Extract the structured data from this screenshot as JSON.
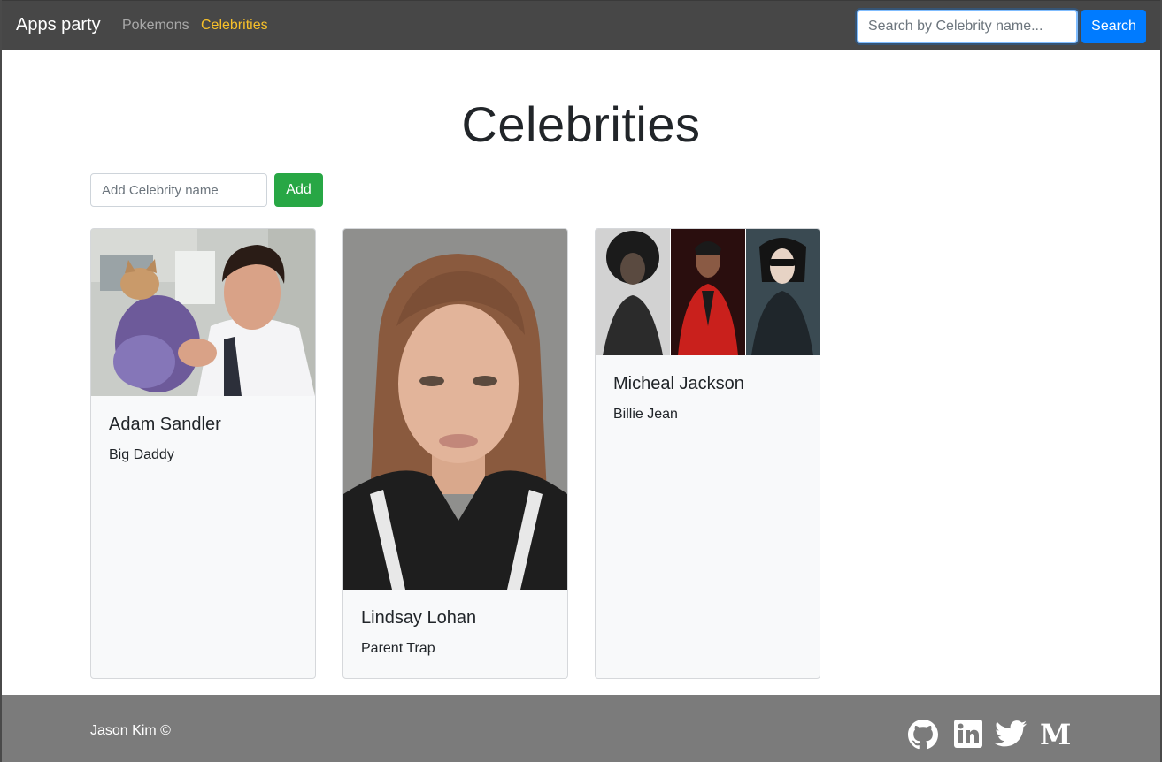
{
  "navbar": {
    "brand": "Apps party",
    "links": [
      {
        "label": "Pokemons",
        "active": false
      },
      {
        "label": "Celebrities",
        "active": true
      }
    ],
    "search": {
      "placeholder": "Search by Celebrity name...",
      "value": "",
      "button_label": "Search"
    }
  },
  "main": {
    "title": "Celebrities",
    "add": {
      "placeholder": "Add Celebrity name",
      "value": "",
      "button_label": "Add"
    },
    "cards": [
      {
        "name": "Adam Sandler",
        "movie": "Big Daddy",
        "image": "adam-sandler-photo"
      },
      {
        "name": "Lindsay Lohan",
        "movie": "Parent Trap",
        "image": "lindsay-lohan-photo"
      },
      {
        "name": "Micheal Jackson",
        "movie": "Billie Jean",
        "image": "micheal-jackson-photo"
      }
    ]
  },
  "footer": {
    "text": "Jason Kim ©",
    "icons": [
      "github-icon",
      "linkedin-icon",
      "twitter-icon",
      "medium-icon"
    ]
  },
  "colors": {
    "navbar_bg": "#474747",
    "active_link": "#f7c02a",
    "search_button": "#007bff",
    "add_button": "#28a745",
    "footer_bg": "#7b7b7b"
  }
}
